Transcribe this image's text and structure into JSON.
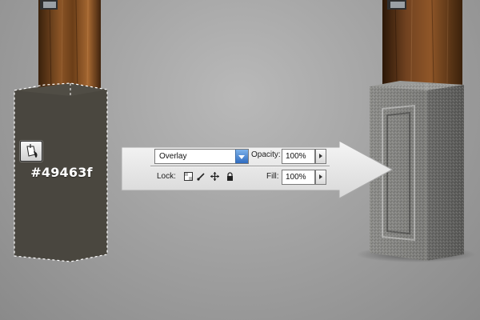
{
  "swatch": {
    "hex_label": "#49463f",
    "fill_color": "#49463f"
  },
  "layers_panel": {
    "blend_mode": "Overlay",
    "opacity_label": "Opacity:",
    "opacity_value": "100%",
    "lock_label": "Lock:",
    "fill_label": "Fill:",
    "fill_value": "100%"
  },
  "icons": [
    "paint-bucket-icon",
    "lock-transparent-pixels-icon",
    "lock-image-pixels-icon",
    "lock-position-icon",
    "lock-all-icon",
    "dropdown-arrow-icon",
    "stepper-arrow-icon",
    "arrow-right-icon"
  ],
  "colors": {
    "background": "#a3a3a3",
    "wood": "#5a3518",
    "stone": "#858582",
    "arrow_fill": "#e9e9e9",
    "blend_button": "#3a77c8"
  }
}
